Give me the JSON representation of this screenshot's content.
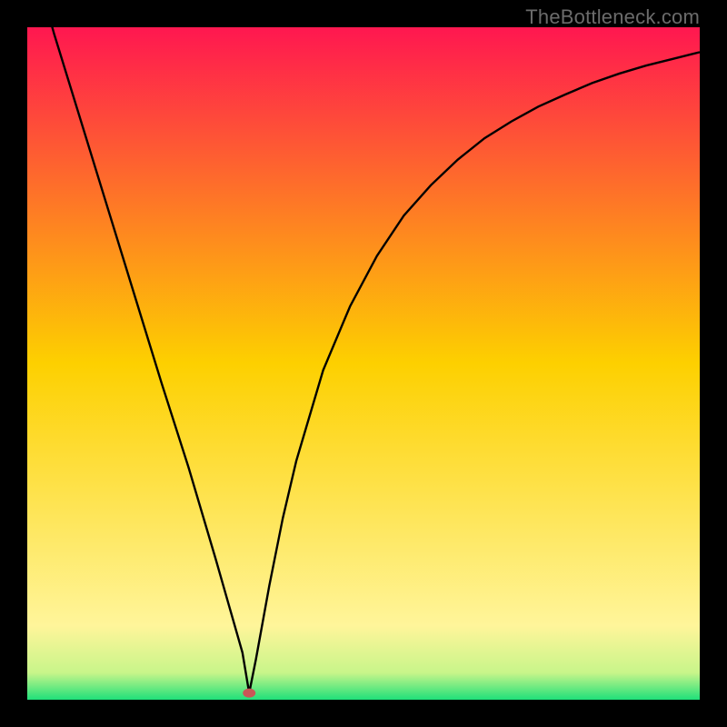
{
  "watermark": "TheBottleneck.com",
  "chart_data": {
    "type": "line",
    "title": "",
    "xlabel": "",
    "ylabel": "",
    "xlim": [
      0,
      100
    ],
    "ylim": [
      0,
      100
    ],
    "grid": false,
    "legend": false,
    "gradient_stops": [
      {
        "offset": 0,
        "color": "#ff1750"
      },
      {
        "offset": 50,
        "color": "#fdd000"
      },
      {
        "offset": 89,
        "color": "#fff59a"
      },
      {
        "offset": 96,
        "color": "#c8f58a"
      },
      {
        "offset": 100,
        "color": "#1fe07a"
      }
    ],
    "marker": {
      "x": 33,
      "y": 1,
      "color": "#c95757"
    },
    "series": [
      {
        "name": "curve",
        "x": [
          0,
          4,
          8,
          12,
          16,
          20,
          24,
          28,
          30,
          32,
          33,
          34,
          36,
          38,
          40,
          44,
          48,
          52,
          56,
          60,
          64,
          68,
          72,
          76,
          80,
          84,
          88,
          92,
          96,
          100
        ],
        "values": [
          113,
          99,
          86,
          73,
          60,
          47,
          34.5,
          21,
          14,
          7,
          1,
          6,
          17,
          27,
          35.5,
          49,
          58.5,
          66,
          72,
          76.5,
          80.3,
          83.5,
          86,
          88.2,
          90,
          91.7,
          93.1,
          94.3,
          95.3,
          96.3
        ]
      }
    ]
  }
}
